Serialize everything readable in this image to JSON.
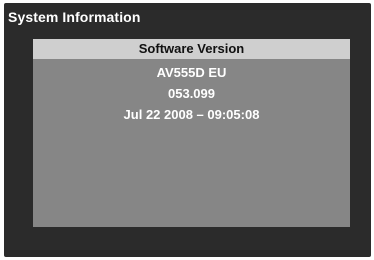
{
  "window": {
    "title": "System Information"
  },
  "panel": {
    "header": "Software Version",
    "lines": [
      "AV555D EU",
      "053.099",
      "Jul 22 2008 – 09:05:08"
    ]
  },
  "colors": {
    "screen_background": "#2b2b2b",
    "panel_background": "#868686",
    "header_background": "#cfcfcf",
    "header_text": "#111111",
    "body_text": "#ffffff"
  }
}
